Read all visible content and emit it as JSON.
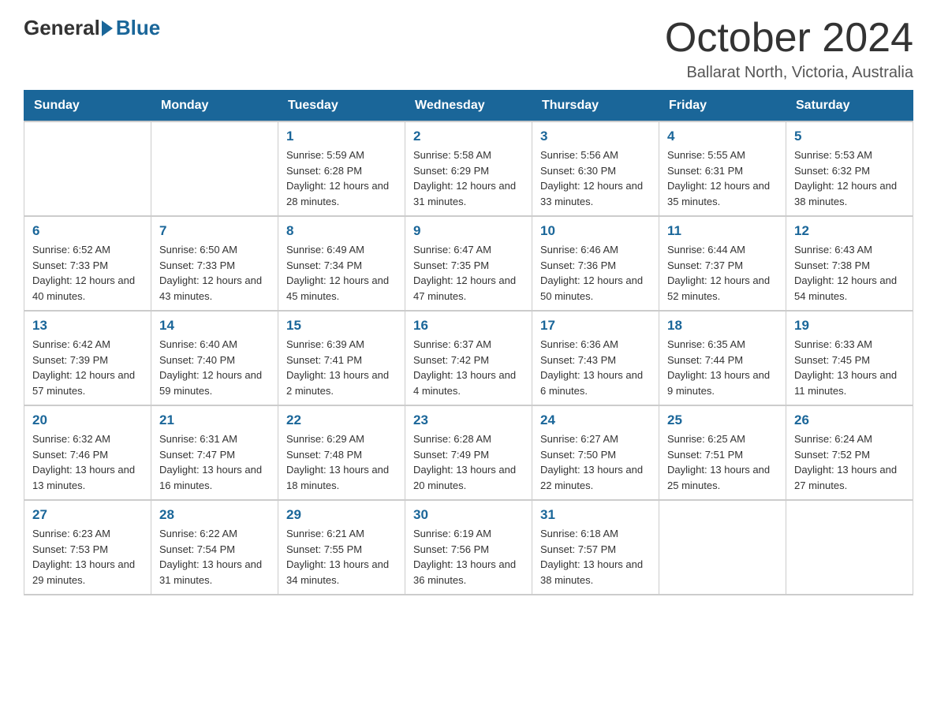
{
  "logo": {
    "general": "General",
    "blue": "Blue"
  },
  "title": "October 2024",
  "location": "Ballarat North, Victoria, Australia",
  "days_of_week": [
    "Sunday",
    "Monday",
    "Tuesday",
    "Wednesday",
    "Thursday",
    "Friday",
    "Saturday"
  ],
  "weeks": [
    [
      {
        "day": "",
        "info": ""
      },
      {
        "day": "",
        "info": ""
      },
      {
        "day": "1",
        "info": "Sunrise: 5:59 AM\nSunset: 6:28 PM\nDaylight: 12 hours\nand 28 minutes."
      },
      {
        "day": "2",
        "info": "Sunrise: 5:58 AM\nSunset: 6:29 PM\nDaylight: 12 hours\nand 31 minutes."
      },
      {
        "day": "3",
        "info": "Sunrise: 5:56 AM\nSunset: 6:30 PM\nDaylight: 12 hours\nand 33 minutes."
      },
      {
        "day": "4",
        "info": "Sunrise: 5:55 AM\nSunset: 6:31 PM\nDaylight: 12 hours\nand 35 minutes."
      },
      {
        "day": "5",
        "info": "Sunrise: 5:53 AM\nSunset: 6:32 PM\nDaylight: 12 hours\nand 38 minutes."
      }
    ],
    [
      {
        "day": "6",
        "info": "Sunrise: 6:52 AM\nSunset: 7:33 PM\nDaylight: 12 hours\nand 40 minutes."
      },
      {
        "day": "7",
        "info": "Sunrise: 6:50 AM\nSunset: 7:33 PM\nDaylight: 12 hours\nand 43 minutes."
      },
      {
        "day": "8",
        "info": "Sunrise: 6:49 AM\nSunset: 7:34 PM\nDaylight: 12 hours\nand 45 minutes."
      },
      {
        "day": "9",
        "info": "Sunrise: 6:47 AM\nSunset: 7:35 PM\nDaylight: 12 hours\nand 47 minutes."
      },
      {
        "day": "10",
        "info": "Sunrise: 6:46 AM\nSunset: 7:36 PM\nDaylight: 12 hours\nand 50 minutes."
      },
      {
        "day": "11",
        "info": "Sunrise: 6:44 AM\nSunset: 7:37 PM\nDaylight: 12 hours\nand 52 minutes."
      },
      {
        "day": "12",
        "info": "Sunrise: 6:43 AM\nSunset: 7:38 PM\nDaylight: 12 hours\nand 54 minutes."
      }
    ],
    [
      {
        "day": "13",
        "info": "Sunrise: 6:42 AM\nSunset: 7:39 PM\nDaylight: 12 hours\nand 57 minutes."
      },
      {
        "day": "14",
        "info": "Sunrise: 6:40 AM\nSunset: 7:40 PM\nDaylight: 12 hours\nand 59 minutes."
      },
      {
        "day": "15",
        "info": "Sunrise: 6:39 AM\nSunset: 7:41 PM\nDaylight: 13 hours\nand 2 minutes."
      },
      {
        "day": "16",
        "info": "Sunrise: 6:37 AM\nSunset: 7:42 PM\nDaylight: 13 hours\nand 4 minutes."
      },
      {
        "day": "17",
        "info": "Sunrise: 6:36 AM\nSunset: 7:43 PM\nDaylight: 13 hours\nand 6 minutes."
      },
      {
        "day": "18",
        "info": "Sunrise: 6:35 AM\nSunset: 7:44 PM\nDaylight: 13 hours\nand 9 minutes."
      },
      {
        "day": "19",
        "info": "Sunrise: 6:33 AM\nSunset: 7:45 PM\nDaylight: 13 hours\nand 11 minutes."
      }
    ],
    [
      {
        "day": "20",
        "info": "Sunrise: 6:32 AM\nSunset: 7:46 PM\nDaylight: 13 hours\nand 13 minutes."
      },
      {
        "day": "21",
        "info": "Sunrise: 6:31 AM\nSunset: 7:47 PM\nDaylight: 13 hours\nand 16 minutes."
      },
      {
        "day": "22",
        "info": "Sunrise: 6:29 AM\nSunset: 7:48 PM\nDaylight: 13 hours\nand 18 minutes."
      },
      {
        "day": "23",
        "info": "Sunrise: 6:28 AM\nSunset: 7:49 PM\nDaylight: 13 hours\nand 20 minutes."
      },
      {
        "day": "24",
        "info": "Sunrise: 6:27 AM\nSunset: 7:50 PM\nDaylight: 13 hours\nand 22 minutes."
      },
      {
        "day": "25",
        "info": "Sunrise: 6:25 AM\nSunset: 7:51 PM\nDaylight: 13 hours\nand 25 minutes."
      },
      {
        "day": "26",
        "info": "Sunrise: 6:24 AM\nSunset: 7:52 PM\nDaylight: 13 hours\nand 27 minutes."
      }
    ],
    [
      {
        "day": "27",
        "info": "Sunrise: 6:23 AM\nSunset: 7:53 PM\nDaylight: 13 hours\nand 29 minutes."
      },
      {
        "day": "28",
        "info": "Sunrise: 6:22 AM\nSunset: 7:54 PM\nDaylight: 13 hours\nand 31 minutes."
      },
      {
        "day": "29",
        "info": "Sunrise: 6:21 AM\nSunset: 7:55 PM\nDaylight: 13 hours\nand 34 minutes."
      },
      {
        "day": "30",
        "info": "Sunrise: 6:19 AM\nSunset: 7:56 PM\nDaylight: 13 hours\nand 36 minutes."
      },
      {
        "day": "31",
        "info": "Sunrise: 6:18 AM\nSunset: 7:57 PM\nDaylight: 13 hours\nand 38 minutes."
      },
      {
        "day": "",
        "info": ""
      },
      {
        "day": "",
        "info": ""
      }
    ]
  ]
}
